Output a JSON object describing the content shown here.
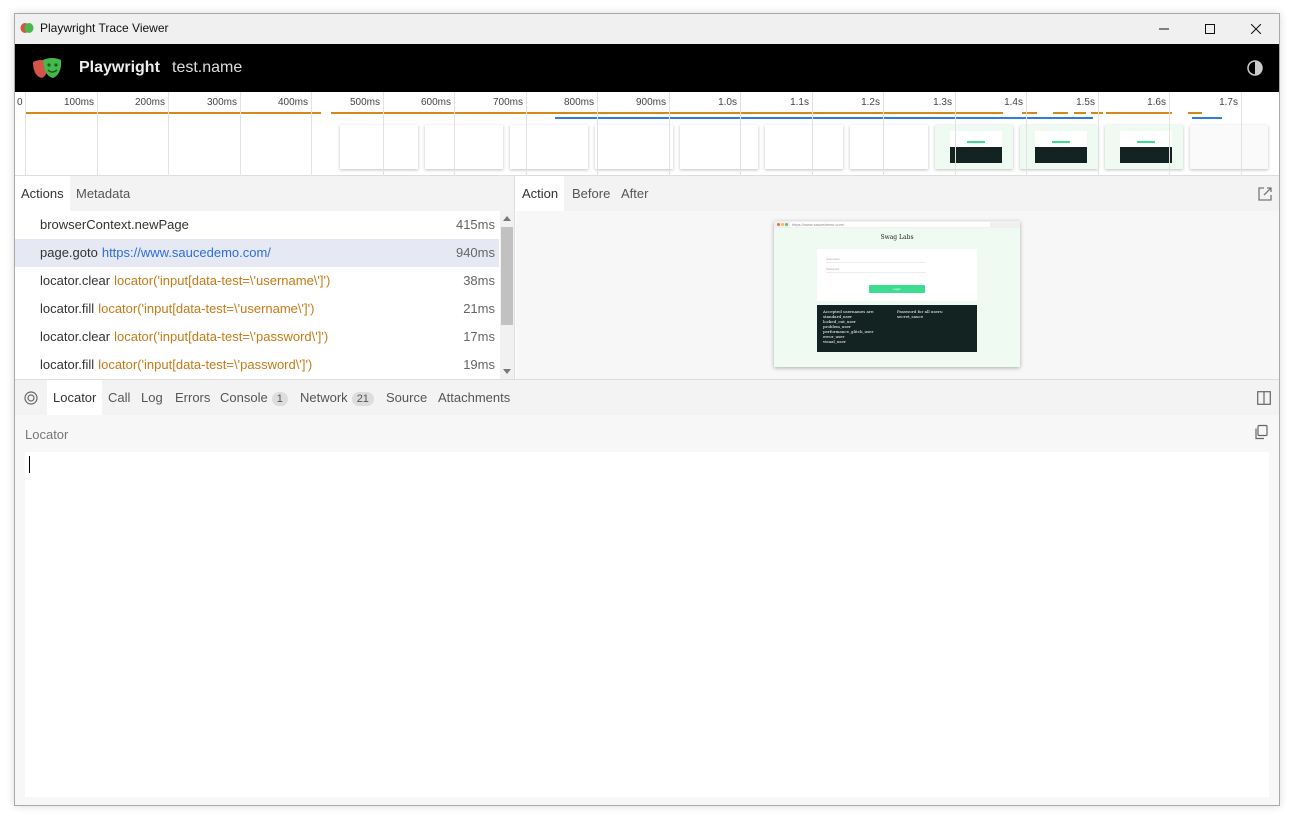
{
  "window": {
    "title": "Playwright Trace Viewer"
  },
  "header": {
    "brand": "Playwright",
    "test_name": "test.name"
  },
  "timeline": {
    "labels": [
      "0",
      "100ms",
      "200ms",
      "300ms",
      "400ms",
      "500ms",
      "600ms",
      "700ms",
      "800ms",
      "900ms",
      "1.0s",
      "1.1s",
      "1.2s",
      "1.3s",
      "1.4s",
      "1.5s",
      "1.6s",
      "1.7s"
    ]
  },
  "left_tabs": [
    "Actions",
    "Metadata"
  ],
  "actions": [
    {
      "name": "browserContext.newPage",
      "arg": "",
      "arg_type": "",
      "duration": "415ms"
    },
    {
      "name": "page.goto",
      "arg": "https://www.saucedemo.com/",
      "arg_type": "url",
      "duration": "940ms"
    },
    {
      "name": "locator.clear",
      "arg": "locator('input[data-test=\\'username\\']')",
      "arg_type": "loc",
      "duration": "38ms"
    },
    {
      "name": "locator.fill",
      "arg": "locator('input[data-test=\\'username\\']')",
      "arg_type": "loc",
      "duration": "21ms"
    },
    {
      "name": "locator.clear",
      "arg": "locator('input[data-test=\\'password\\']')",
      "arg_type": "loc",
      "duration": "17ms"
    },
    {
      "name": "locator.fill",
      "arg": "locator('input[data-test=\\'password\\']')",
      "arg_type": "loc",
      "duration": "19ms"
    }
  ],
  "right_tabs": [
    "Action",
    "Before",
    "After"
  ],
  "preview": {
    "url": "https://www.saucedemo.com/",
    "page_title": "Swag Labs",
    "username_placeholder": "Username",
    "password_placeholder": "Password",
    "login_label": "Login",
    "usernames_text": "Accepted usernames are:\nstandard_user\nlocked_out_user\nproblem_user\nperformance_glitch_user\nerror_user\nvisual_user",
    "password_text": "Password for all users:\nsecret_sauce"
  },
  "bottom_tabs": {
    "locator": "Locator",
    "call": "Call",
    "log": "Log",
    "errors": "Errors",
    "console": "Console",
    "console_count": "1",
    "network": "Network",
    "network_count": "21",
    "source": "Source",
    "attachments": "Attachments"
  },
  "locator_panel": {
    "label": "Locator",
    "value": ""
  },
  "colors": {
    "accent_orange": "#d48a1a",
    "accent_blue": "#2f7fd6",
    "url_link": "#2d6fd6",
    "locator_arg": "#c77a16",
    "selected_row": "#e6e9f3"
  }
}
